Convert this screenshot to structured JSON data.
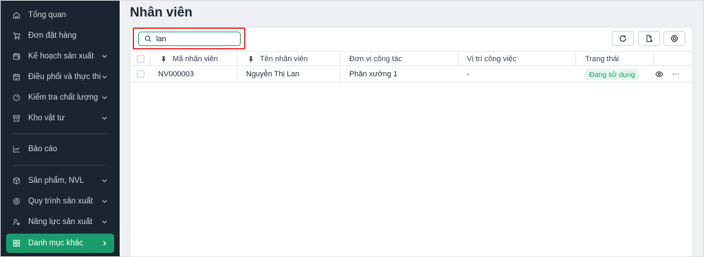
{
  "sidebar": {
    "items": [
      {
        "label": "Tổng quan",
        "icon": "home-icon",
        "has_chevron": false
      },
      {
        "label": "Đơn đặt hàng",
        "icon": "cart-icon",
        "has_chevron": false
      },
      {
        "label": "Kế hoạch sản xuất",
        "icon": "calendar-plus-icon",
        "has_chevron": true
      },
      {
        "label": "Điều phối và thực thi",
        "icon": "calendar-check-icon",
        "has_chevron": true
      },
      {
        "label": "Kiểm tra chất lượng",
        "icon": "gauge-icon",
        "has_chevron": true
      },
      {
        "label": "Kho vật tư",
        "icon": "box-icon",
        "has_chevron": true
      },
      {
        "label": "Báo cáo",
        "icon": "chart-icon",
        "has_chevron": false
      },
      {
        "label": "Sản phẩm, NVL",
        "icon": "cube-icon",
        "has_chevron": true
      },
      {
        "label": "Quy trình sản xuất",
        "icon": "process-icon",
        "has_chevron": true
      },
      {
        "label": "Năng lực sản xuất",
        "icon": "people-gear-icon",
        "has_chevron": true
      },
      {
        "label": "Danh mục khác",
        "icon": "grid-icon",
        "has_chevron": true,
        "active": true
      }
    ]
  },
  "page": {
    "title": "Nhân viên"
  },
  "search": {
    "value": "lan",
    "placeholder": ""
  },
  "toolbar": {
    "refresh_icon": "refresh-icon",
    "export_icon": "export-file-icon",
    "settings_icon": "settings-icon"
  },
  "table": {
    "columns": [
      "Mã nhân viên",
      "Tên nhân viên",
      "Đơn vị công tác",
      "Vị trí công việc",
      "Trạng thái"
    ],
    "rows": [
      {
        "code": "NV000003",
        "name": "Nguyễn Thị Lan",
        "unit": "Phân xưởng 1",
        "position": "-",
        "status": "Đang sử dụng"
      }
    ]
  },
  "colors": {
    "accent": "#1a9b6c",
    "sidebar_bg": "#1b2430",
    "highlight": "#e53935"
  }
}
